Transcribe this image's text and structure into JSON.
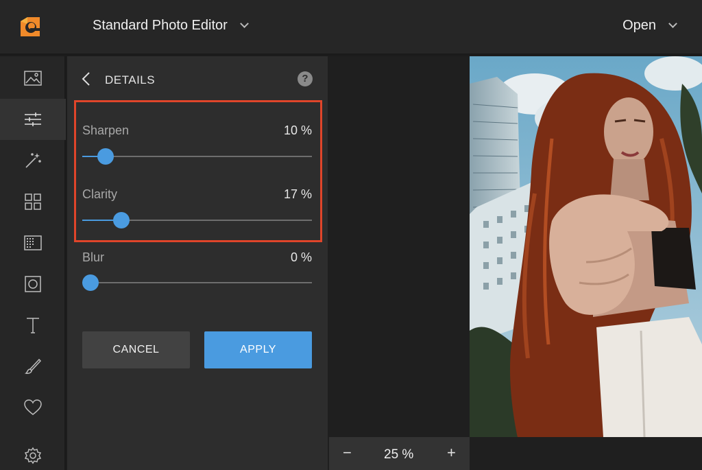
{
  "header": {
    "app_title": "Standard Photo Editor",
    "open_label": "Open"
  },
  "toolbar": {
    "items": [
      {
        "icon": "image-icon",
        "active": false
      },
      {
        "icon": "sliders-icon",
        "active": true
      },
      {
        "icon": "magic-wand-icon",
        "active": false
      },
      {
        "icon": "grid-icon",
        "active": false
      },
      {
        "icon": "texture-icon",
        "active": false
      },
      {
        "icon": "frame-icon",
        "active": false
      },
      {
        "icon": "text-icon",
        "active": false
      },
      {
        "icon": "brush-icon",
        "active": false
      },
      {
        "icon": "heart-icon",
        "active": false
      },
      {
        "icon": "gear-icon",
        "active": false
      }
    ]
  },
  "panel": {
    "title": "DETAILS",
    "help": "?",
    "sliders": [
      {
        "label": "Sharpen",
        "value": 10,
        "value_text": "10 %"
      },
      {
        "label": "Clarity",
        "value": 17,
        "value_text": "17 %"
      },
      {
        "label": "Blur",
        "value": 0,
        "value_text": "0 %"
      }
    ],
    "cancel_label": "CANCEL",
    "apply_label": "APPLY"
  },
  "canvas": {
    "zoom_minus": "−",
    "zoom_value": "25 %",
    "zoom_plus": "+"
  },
  "colors": {
    "accent": "#4a9be0",
    "highlight": "#e0452a"
  }
}
